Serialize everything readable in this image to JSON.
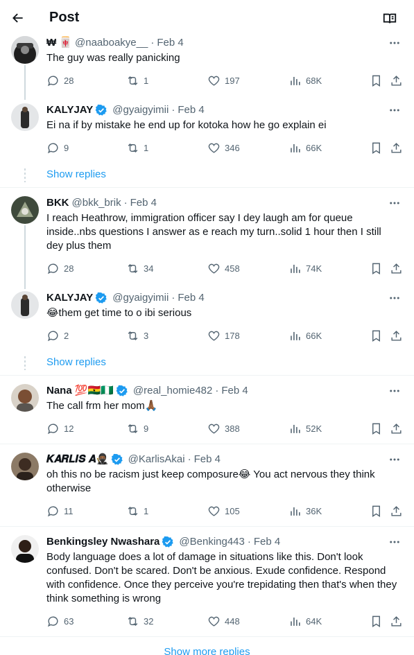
{
  "header": {
    "title": "Post",
    "back_icon": "arrow-left-icon",
    "reader_icon": "book-icon"
  },
  "colors": {
    "accent": "#1d9bf0",
    "secondary_text": "#536471",
    "divider": "#eff3f4",
    "thread_line": "#cfd9de"
  },
  "tweets": [
    {
      "name": "₩ 🀄",
      "handle": "@naaboakye__",
      "date": "Feb 4",
      "verified": false,
      "text": "The guy was really panicking",
      "replies": "28",
      "retweets": "1",
      "likes": "197",
      "views": "68K"
    },
    {
      "name": "KALYJAY",
      "handle": "@gyaigyimii",
      "date": "Feb 4",
      "verified": true,
      "text": "Ei na if by mistake he end up for kotoka how he go explain ei",
      "replies": "9",
      "retweets": "1",
      "likes": "346",
      "views": "66K"
    },
    {
      "name": "BKK",
      "handle": "@bkk_brik",
      "date": "Feb 4",
      "verified": false,
      "text": "I reach Heathrow, immigration officer say I dey laugh am for queue inside..nbs questions I answer as e reach my turn..solid 1 hour then I still dey plus them",
      "replies": "28",
      "retweets": "34",
      "likes": "458",
      "views": "74K"
    },
    {
      "name": "KALYJAY",
      "handle": "@gyaigyimii",
      "date": "Feb 4",
      "verified": true,
      "text": "😂them get time to o ibi serious",
      "replies": "2",
      "retweets": "3",
      "likes": "178",
      "views": "66K"
    },
    {
      "name": "Nana 💯🇬🇭🇳🇬",
      "handle": "@real_homie482",
      "date": "Feb 4",
      "verified": true,
      "text": "The call frm her mom🙏🏾",
      "replies": "12",
      "retweets": "9",
      "likes": "388",
      "views": "52K"
    },
    {
      "name": "𝑲𝑨𝑹𝑳𝑰𝑺 𝑨🥷🏾",
      "handle": "@KarlisAkai",
      "date": "Feb 4",
      "verified": true,
      "text": "oh this no be racism just keep composure😂 You act nervous they think otherwise",
      "replies": "11",
      "retweets": "1",
      "likes": "105",
      "views": "36K"
    },
    {
      "name": "Benkingsley Nwashara",
      "handle": "@Benking443",
      "date": "Feb 4",
      "verified": true,
      "text": "Body language does a lot of damage in situations like this. Don't look confused. Don't be scared. Don't be anxious. Exude confidence. Respond with confidence. Once they perceive you're trepidating then that's when they think something is wrong",
      "replies": "63",
      "retweets": "32",
      "likes": "448",
      "views": "64K"
    }
  ],
  "show_replies_label": "Show replies",
  "show_more_label": "Show more replies"
}
